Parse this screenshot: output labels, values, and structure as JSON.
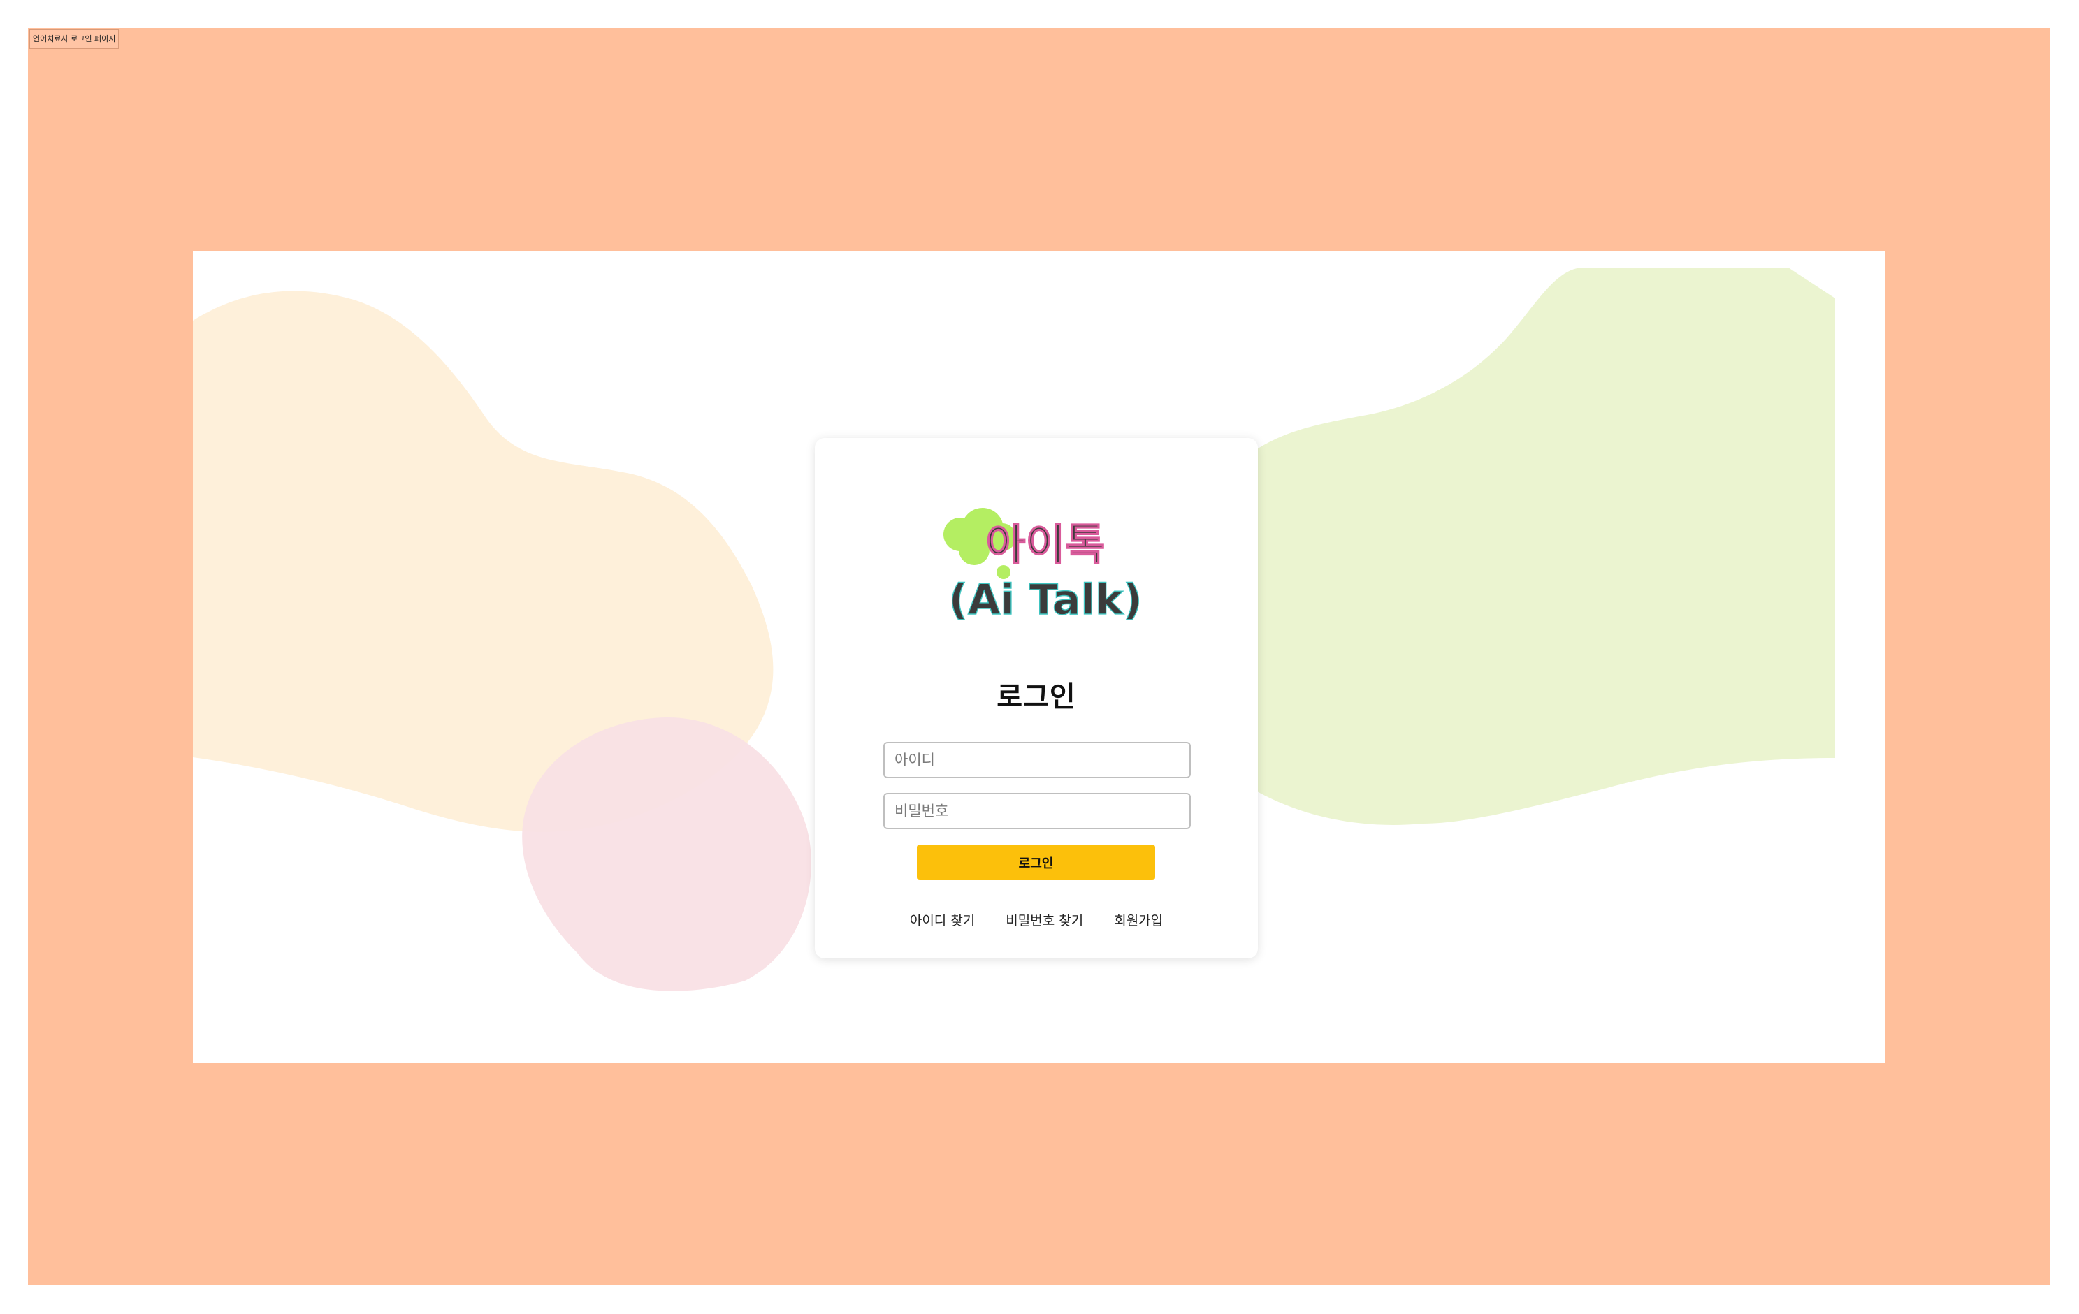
{
  "window": {
    "tab_label": "언어치료사 로그인 페이지"
  },
  "colors": {
    "frame_background": "#FFBF9B",
    "canvas_background": "#FFFFFF",
    "blob_left": "#FEF0DA",
    "blob_right": "#EBF4D0",
    "blob_pink": "#F9E0E5",
    "logo_cloud": "#B4EE62",
    "logo_text": "#3B3B3B",
    "button_background": "#FCC00B"
  },
  "logo": {
    "line1": "아이톡",
    "line2": "(Ai Talk)"
  },
  "login": {
    "title": "로그인",
    "id_placeholder": "아이디",
    "password_placeholder": "비밀번호",
    "submit_label": "로그인"
  },
  "links": {
    "find_id": "아이디 찾기",
    "find_password": "비밀번호 찾기",
    "signup": "회원가입"
  }
}
